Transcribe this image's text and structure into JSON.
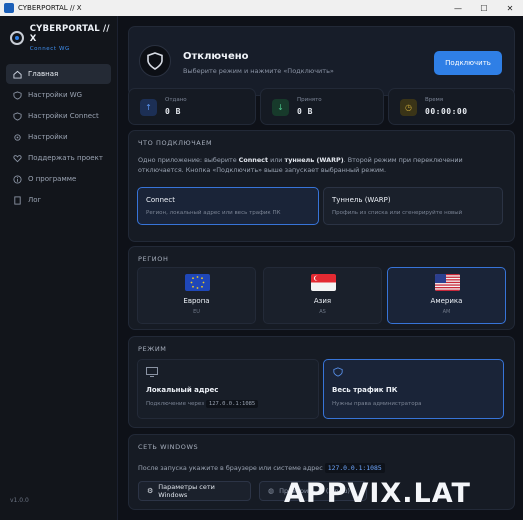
{
  "window": {
    "title": "CYBERPORTAL // X",
    "controls": [
      "—",
      "☐",
      "✕"
    ]
  },
  "brand": {
    "name": "CYBERPORTAL // X",
    "subtitle": "Connect  WG"
  },
  "sidebar": {
    "items": [
      {
        "label": "Главная",
        "icon": "home-icon",
        "active": true
      },
      {
        "label": "Настройки WG",
        "icon": "shield-icon",
        "active": false
      },
      {
        "label": "Настройки Connect",
        "icon": "shield-icon",
        "active": false
      },
      {
        "label": "Настройки",
        "icon": "gear-icon",
        "active": false
      },
      {
        "label": "Поддержать проект",
        "icon": "heart-icon",
        "active": false
      },
      {
        "label": "О программе",
        "icon": "info-icon",
        "active": false
      },
      {
        "label": "Лог",
        "icon": "document-icon",
        "active": false
      }
    ],
    "version": "v1.0.0"
  },
  "status": {
    "title": "Отключено",
    "subtitle": "Выберите режим и нажмите «Подключить»",
    "button": "Подключить"
  },
  "stats": {
    "sent": {
      "label": "Отдано",
      "value": "0 B"
    },
    "received": {
      "label": "Принято",
      "value": "0 B"
    },
    "time": {
      "label": "Время",
      "value": "00:00:00"
    }
  },
  "what": {
    "title": "ЧТО ПОДКЛЮЧАЕМ",
    "desc_1": "Одно приложение: выберите ",
    "desc_connect": "Connect",
    "desc_2": " или ",
    "desc_warp": "туннель (WARP)",
    "desc_3": ". Второй режим при переключении отключается. Кнопка «Подключить» выше запускает выбранный режим.",
    "options": [
      {
        "title": "Connect",
        "subtitle": "Регион, локальный адрес или весь трафик ПК"
      },
      {
        "title": "Туннель (WARP)",
        "subtitle": "Профиль из списка или сгенерируйте новый"
      }
    ]
  },
  "region": {
    "title": "РЕГИОН",
    "items": [
      {
        "name": "Европа",
        "code": "EU"
      },
      {
        "name": "Азия",
        "code": "AS"
      },
      {
        "name": "Америка",
        "code": "AM"
      }
    ]
  },
  "mode": {
    "title": "РЕЖИМ",
    "local": {
      "title": "Локальный адрес",
      "subtitle_prefix": "Подключение через",
      "address": "127.0.0.1:1085"
    },
    "full": {
      "title": "Весь трафик ПК",
      "subtitle": "Нужны права администратора"
    }
  },
  "windows": {
    "title": "СЕТЬ WINDOWS",
    "desc": "После запуска укажите в браузере или системе адрес",
    "address": "127.0.0.1:1085",
    "btn_settings": "Параметры сети Windows",
    "btn_check": "Проверить IP (2ip.ru)"
  },
  "watermark": "APPVIX.LAT",
  "colors": {
    "accent": "#2f7fe6",
    "background": "#0e1118",
    "card": "#161b24"
  }
}
